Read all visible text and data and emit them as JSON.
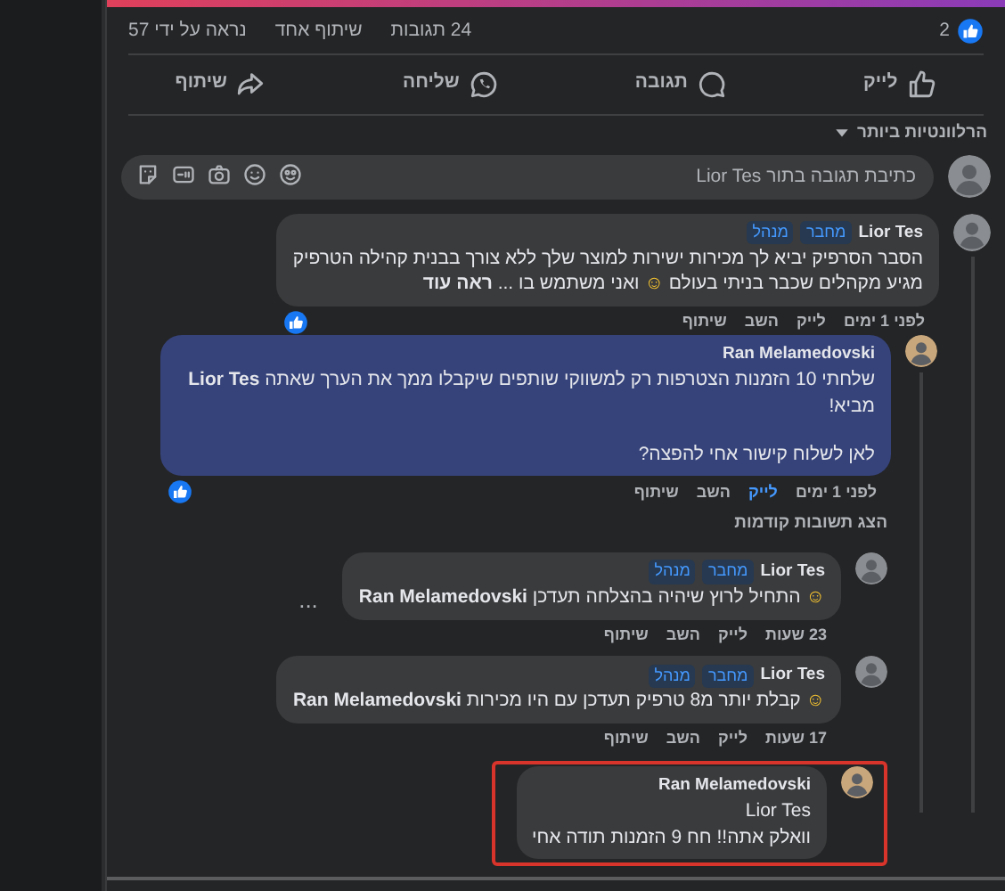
{
  "post_stats": {
    "reactions": "2",
    "comments": "24 תגובות",
    "shares": "שיתוף אחד",
    "views": "נראה על ידי 57"
  },
  "actions": [
    {
      "kind": "like",
      "label": "לייק"
    },
    {
      "kind": "comment",
      "label": "תגובה"
    },
    {
      "kind": "send",
      "label": "שליחה"
    },
    {
      "kind": "share",
      "label": "שיתוף"
    }
  ],
  "sort": {
    "label": "הרלוונטיות ביותר"
  },
  "composer": {
    "placeholder": "כתיבת תגובה בתור Lior Tes"
  },
  "comments": [
    {
      "author": "Lior Tes",
      "color": "#8a8d91",
      "badges": [
        "מחבר",
        "מנהל"
      ],
      "highlighted": false,
      "framed": false,
      "text": [
        "הסבר הסרפיק יביא לך מכירות ישירות למוצר שלך ללא צורך בבנית קהילה הטרפיק מגיע מקהלים שכבר בניתי בעולם ☺ ואני משתמש בו ..."
      ],
      "see_more": "ראה עוד",
      "time": "לפני 1 ימים",
      "like": "לייק",
      "liked": false,
      "reply": "השב",
      "share": "שיתוף",
      "has_reaction": true,
      "children": [
        {
          "author": "Ran Melamedovski",
          "color": "#c9a77c",
          "highlighted": true,
          "framed": false,
          "text": [
            "שלחתי 10 הזמנות הצטרפות רק למשווקי שותפים שיקבלו ממך את הערך שאתה **Lior Tes** מביא!",
            "לאן לשלוח קישור אחי להפצה?"
          ],
          "time": "לפני 1 ימים",
          "like": "לייק",
          "liked": true,
          "reply": "השב",
          "share": "שיתוף",
          "has_reaction": true,
          "previous_replies": "הצג תשובות קודמות",
          "children": [
            {
              "author": "Lior Tes",
              "color": "#8a8d91",
              "badges": [
                "מחבר",
                "מנהל"
              ],
              "highlighted": false,
              "framed": false,
              "text": [
                "☺ התחיל לרוץ שיהיה בהצלחה תעדכן **Ran Melamedovski**"
              ],
              "menu": "...",
              "time": "23 שעות",
              "like": "לייק",
              "liked": false,
              "reply": "השב",
              "share": "שיתוף"
            },
            {
              "author": "Lior Tes",
              "color": "#8a8d91",
              "badges": [
                "מחבר",
                "מנהל"
              ],
              "highlighted": false,
              "framed": false,
              "text": [
                "☺ קבלת יותר מ8 טרפיק תעדכן עם היו מכירות **Ran Melamedovski**"
              ],
              "time": "17 שעות",
              "like": "לייק",
              "liked": false,
              "reply": "השב",
              "share": "שיתוף"
            },
            {
              "author": "Ran Melamedovski",
              "color": "#c9a77c",
              "highlighted": false,
              "framed": true,
              "text": [
                "Lior Tes",
                "וואלק אתה!! חח 9 הזמנות תודה אחי"
              ]
            }
          ]
        }
      ]
    }
  ]
}
